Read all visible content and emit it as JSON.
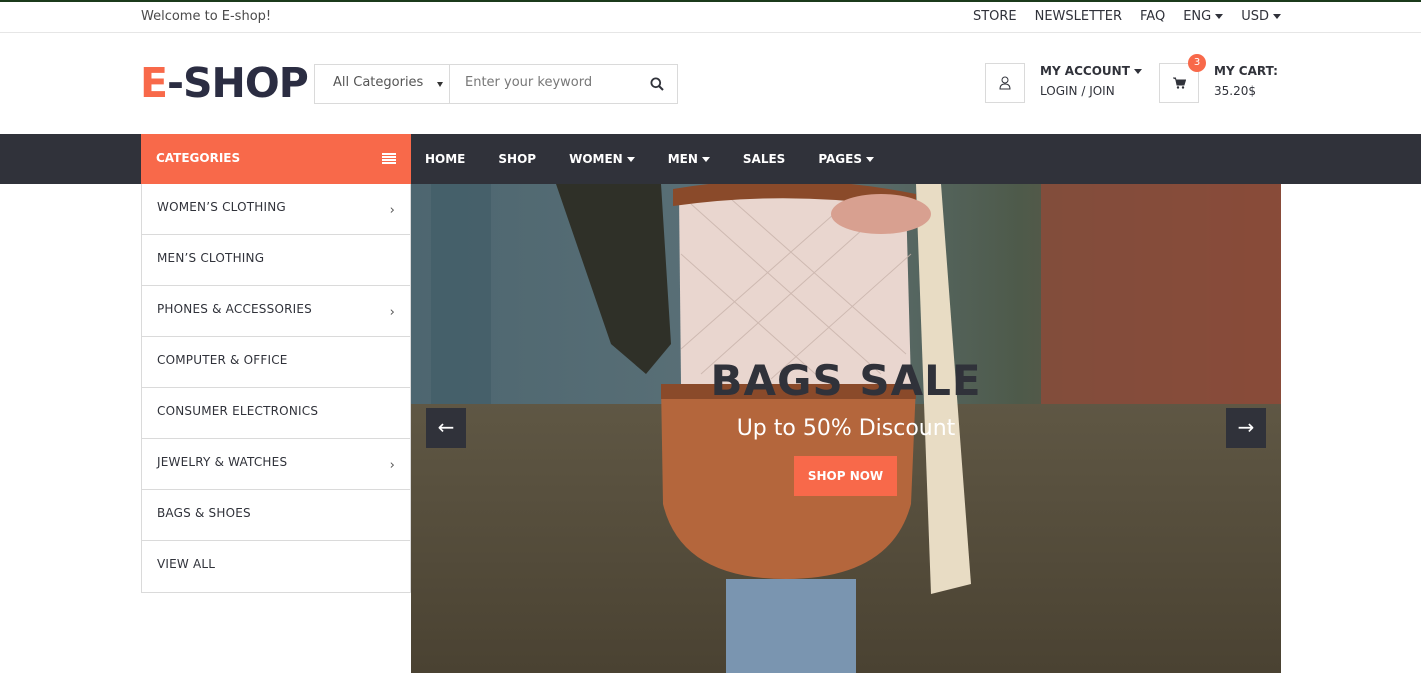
{
  "topbar": {
    "welcome": "Welcome to E-shop!",
    "links": [
      "STORE",
      "NEWSLETTER",
      "FAQ"
    ],
    "language": "ENG",
    "currency": "USD"
  },
  "header": {
    "logo_accent": "E",
    "logo_rest": "-SHOP",
    "search": {
      "category": "All Categories",
      "placeholder": "Enter your keyword"
    },
    "account": {
      "title": "MY ACCOUNT",
      "subtitle": "LOGIN / JOIN"
    },
    "cart": {
      "title": "MY CART:",
      "total": "35.20$",
      "count": "3"
    }
  },
  "nav": {
    "categories_label": "CATEGORIES",
    "items": [
      "HOME",
      "SHOP",
      "WOMEN",
      "MEN",
      "SALES",
      "PAGES"
    ]
  },
  "categories": [
    "WOMEN’S CLOTHING",
    "MEN’S CLOTHING",
    "PHONES & ACCESSORIES",
    "COMPUTER & OFFICE",
    "CONSUMER ELECTRONICS",
    "JEWELRY & WATCHES",
    "BAGS & SHOES",
    "VIEW ALL"
  ],
  "banner": {
    "title": "BAGS SALE",
    "subtitle": "Up to 50% Discount",
    "button": "SHOP NOW"
  },
  "colors": {
    "accent": "#f8694a",
    "dark": "#30323a",
    "border": "#dadada"
  },
  "icons": [
    "search-icon",
    "user-icon",
    "cart-icon",
    "menu-bars-icon",
    "chevron-right-icon",
    "arrow-left-icon",
    "arrow-right-icon"
  ]
}
